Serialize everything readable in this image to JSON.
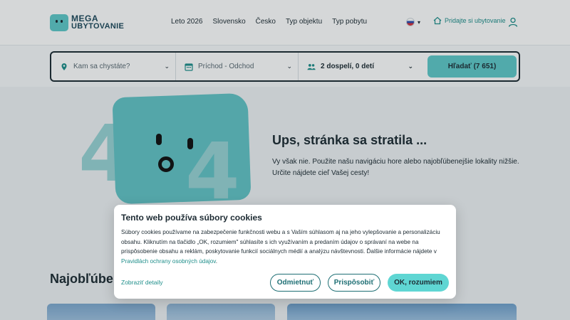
{
  "logo": {
    "line1": "MEGA",
    "line2": "UBYTOVANIE"
  },
  "nav": {
    "items": [
      "Leto 2026",
      "Slovensko",
      "Česko",
      "Typ objektu",
      "Typ pobytu"
    ]
  },
  "header": {
    "add_property": "Pridajte si ubytovanie"
  },
  "search": {
    "destination_placeholder": "Kam sa chystáte?",
    "dates_placeholder": "Príchod - Odchod",
    "guests_value": "2 dospelí, 0 detí",
    "submit_label": "Hľadať (7 651)"
  },
  "hero": {
    "title": "Ups, stránka sa stratila ...",
    "text": "Vy však nie. Použite našu navigáciu hore alebo najobľúbenejšie lokality nižšie. Určite nájdete cieľ Vašej cesty!"
  },
  "section": {
    "title_visible": "Najobľúben"
  },
  "cookie": {
    "title": "Tento web používa súbory cookies",
    "text": "Súbory cookies používame na zabezpečenie funkčnosti webu a s Vaším súhlasom aj na jeho vylepšovanie a personalizáciu obsahu. Kliknutím na tlačidlo „OK, rozumiem\" súhlasíte s ich využívaním a predaním údajov o správaní na webe na prispôsobenie obsahu a reklám, poskytovanie funkcií sociálnych médií a analýzu návštevnosti. Ďalšie informácie nájdete v",
    "link": "Pravidlách ochrany osobných údajov",
    "text_end": ".",
    "details": "Zobraziť detaily",
    "decline": "Odmietnuť",
    "customize": "Prispôsobiť",
    "accept": "OK, rozumiem"
  },
  "colors": {
    "accent": "#5fc9c9",
    "brand_dark": "#1e4a5c",
    "link": "#1e8e8a"
  }
}
